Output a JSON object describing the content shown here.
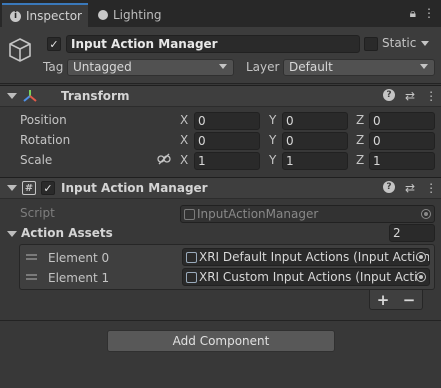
{
  "tabs": {
    "inspector": "Inspector",
    "lighting": "Lighting"
  },
  "header": {
    "active": true,
    "object_name": "Input Action Manager",
    "static_label": "Static",
    "tag_label": "Tag",
    "tag_value": "Untagged",
    "layer_label": "Layer",
    "layer_value": "Default"
  },
  "transform": {
    "title": "Transform",
    "position_label": "Position",
    "rotation_label": "Rotation",
    "scale_label": "Scale",
    "x": "X",
    "y": "Y",
    "z": "Z",
    "position": {
      "x": "0",
      "y": "0",
      "z": "0"
    },
    "rotation": {
      "x": "0",
      "y": "0",
      "z": "0"
    },
    "scale": {
      "x": "1",
      "y": "1",
      "z": "1"
    }
  },
  "component": {
    "title": "Input Action Manager",
    "enabled": true,
    "script_label": "Script",
    "script_value": "InputActionManager",
    "assets_label": "Action Assets",
    "assets_count": "2",
    "elements": [
      {
        "label": "Element 0",
        "value": "XRI Default Input Actions (Input Action"
      },
      {
        "label": "Element 1",
        "value": "XRI Custom Input Actions (Input Actio"
      }
    ],
    "plus": "+",
    "minus": "−"
  },
  "add_component_label": "Add Component",
  "colors": {
    "background": "#383838",
    "tab_accent": "#3a79bb",
    "field_bg": "#2a2a2a"
  }
}
